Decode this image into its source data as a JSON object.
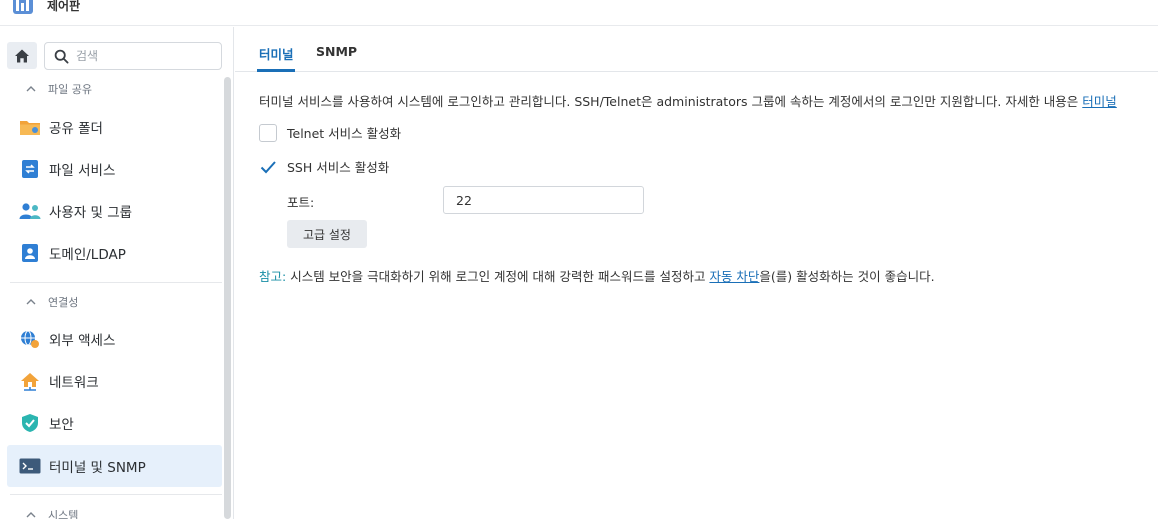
{
  "window": {
    "title": "제어판"
  },
  "sidebar": {
    "search_placeholder": "검색",
    "sections": [
      {
        "label": "파일 공유"
      },
      {
        "label": "연결성"
      },
      {
        "label": "시스템"
      }
    ],
    "items": [
      {
        "label": "공유 폴더",
        "icon": "shared-folder-icon"
      },
      {
        "label": "파일 서비스",
        "icon": "file-services-icon"
      },
      {
        "label": "사용자 및 그룹",
        "icon": "user-group-icon"
      },
      {
        "label": "도메인/LDAP",
        "icon": "domain-ldap-icon"
      },
      {
        "label": "외부 액세스",
        "icon": "external-access-icon"
      },
      {
        "label": "네트워크",
        "icon": "network-icon"
      },
      {
        "label": "보안",
        "icon": "security-shield-icon"
      },
      {
        "label": "터미널 및 SNMP",
        "icon": "terminal-icon",
        "active": true
      }
    ]
  },
  "tabs": [
    {
      "label": "터미널",
      "active": true
    },
    {
      "label": "SNMP",
      "active": false
    }
  ],
  "terminal": {
    "description": "터미널 서비스를 사용하여 시스템에 로그인하고 관리합니다. SSH/Telnet은 administrators 그룹에 속하는 계정에서의 로그인만 지원합니다. 자세한 내용은 ",
    "description_link": "터미널",
    "telnet_label": "Telnet 서비스 활성화",
    "telnet_checked": false,
    "ssh_label": "SSH 서비스 활성화",
    "ssh_checked": true,
    "port_label": "포트:",
    "port_value": "22",
    "advanced_button": "고급 설정",
    "note_prefix": "참고:",
    "note_text": " 시스템 보안을 극대화하기 위해 로그인 계정에 대해 강력한 패스워드를 설정하고 ",
    "note_link": "자동 차단",
    "note_suffix": "을(를) 활성화하는 것이 좋습니다."
  },
  "colors": {
    "accent": "#1a6fb7",
    "active_item_bg": "#e6f0fb",
    "note_prefix": "#1a8fa6"
  }
}
